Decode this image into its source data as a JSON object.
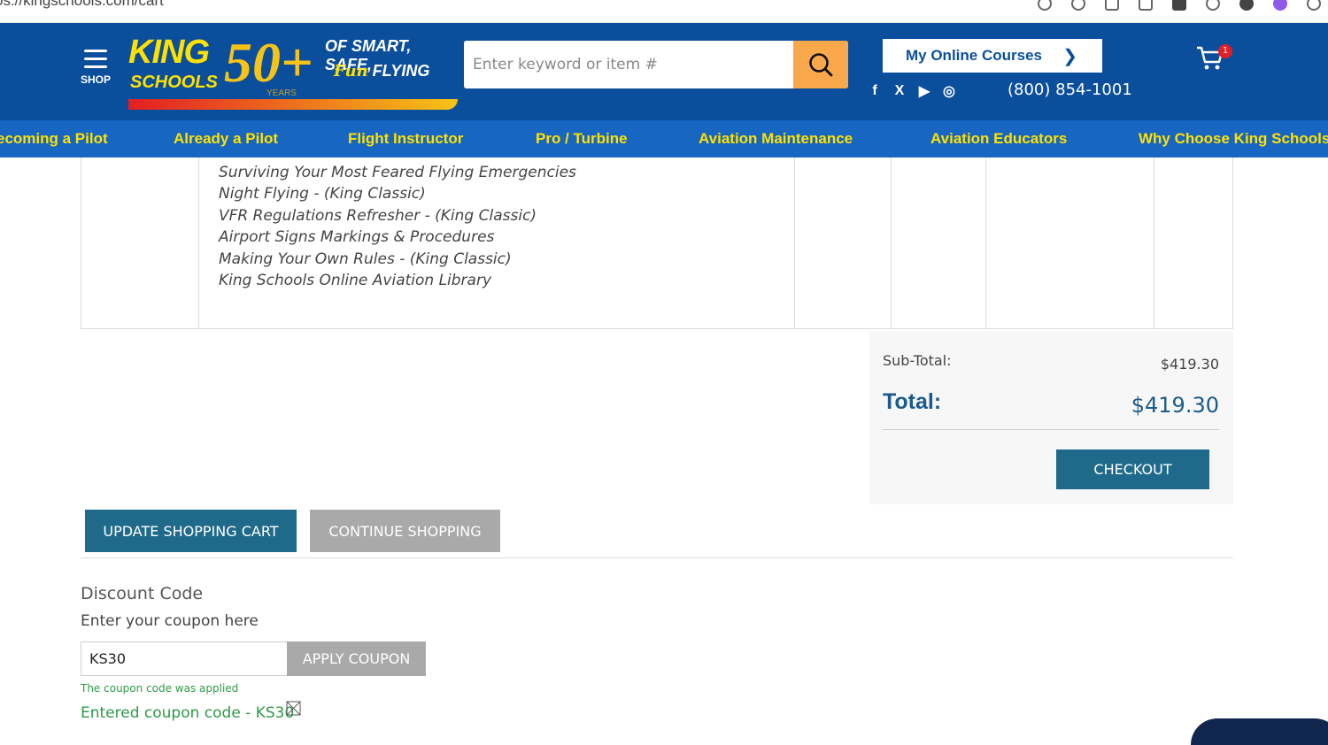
{
  "browser": {
    "url": "os://kingschools.com/cart"
  },
  "header": {
    "shop_label": "SHOP",
    "logo": {
      "king": "KING",
      "schools": "SCHOOLS",
      "fifty": "50+",
      "years": "YEARS",
      "tagline_1": "OF SMART, SAFE,",
      "tagline_fun": "Fun",
      "tagline_2": "FLYING"
    },
    "search": {
      "placeholder": "Enter keyword or item #"
    },
    "my_courses_label": "My Online Courses",
    "social": [
      "f",
      "X",
      "▶",
      "◎"
    ],
    "phone": "(800) 854-1001",
    "cart_count": "1"
  },
  "nav": {
    "items": [
      "ecoming a Pilot",
      "Already a Pilot",
      "Flight Instructor",
      "Pro / Turbine",
      "Aviation Maintenance",
      "Aviation Educators",
      "Why Choose King Schools"
    ]
  },
  "cart": {
    "course_items": [
      "Surviving Your Most Feared Flying Emergencies",
      "Night Flying - (King Classic)",
      "VFR Regulations Refresher - (King Classic)",
      "Airport Signs Markings & Procedures",
      "Making Your Own Rules - (King Classic)",
      "King Schools Online Aviation Library"
    ]
  },
  "totals": {
    "subtotal_label": "Sub-Total:",
    "subtotal_value": "$419.30",
    "total_label": "Total:",
    "total_value": "$419.30",
    "checkout_label": "CHECKOUT"
  },
  "actions": {
    "update_label": "UPDATE SHOPPING CART",
    "continue_label": "CONTINUE SHOPPING"
  },
  "discount": {
    "title": "Discount Code",
    "hint": "Enter your coupon here",
    "coupon_value": "KS30",
    "apply_label": "APPLY COUPON",
    "applied_message": "The coupon code was applied",
    "entered_code_text": "Entered coupon code - KS30"
  },
  "colors": {
    "header_blue": "#0b4f9c",
    "nav_blue": "#1766c2",
    "nav_text_yellow": "#ffe100",
    "search_button_orange": "#f9a94b",
    "primary_teal": "#1f6a8a",
    "secondary_gray": "#a9a9a9",
    "success_green": "#2e9a48",
    "total_blue": "#1a5b8c"
  }
}
